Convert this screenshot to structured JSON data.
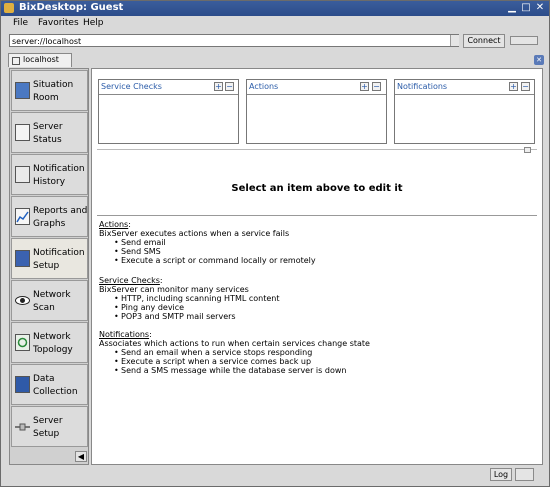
{
  "window": {
    "title": "BixDesktop: Guest"
  },
  "menu": [
    "File",
    "Favorites",
    "Help"
  ],
  "address": {
    "value": "server://localhost",
    "connect_label": "Connect"
  },
  "tab": {
    "label": "localhost"
  },
  "sidebar": {
    "items": [
      {
        "label": "Situation Room",
        "icon": "monitor-icon"
      },
      {
        "label": "Server Status",
        "icon": "checklist-icon"
      },
      {
        "label": "Notification History",
        "icon": "documents-icon"
      },
      {
        "label": "Reports and Graphs",
        "icon": "graph-icon"
      },
      {
        "label": "Notification Setup",
        "icon": "notification-setup-icon"
      },
      {
        "label": "Network Scan",
        "icon": "eye-icon"
      },
      {
        "label": "Network Topology",
        "icon": "topology-icon"
      },
      {
        "label": "Data Collection",
        "icon": "book-icon"
      },
      {
        "label": "Server Setup",
        "icon": "network-plug-icon"
      }
    ],
    "active_index": 4
  },
  "panels": [
    {
      "title": "Service Checks",
      "add": "+",
      "remove": "−"
    },
    {
      "title": "Actions",
      "add": "+",
      "remove": "−"
    },
    {
      "title": "Notifications",
      "add": "+",
      "remove": "−"
    }
  ],
  "main": {
    "prompt": "Select an item above to edit it"
  },
  "help": {
    "actions": {
      "heading": "Actions",
      "desc": "BixServer executes actions when a service fails",
      "bullets": [
        "Send email",
        "Send SMS",
        "Execute a script or command locally or remotely"
      ]
    },
    "service_checks": {
      "heading": "Service Checks",
      "desc": "BixServer can monitor many services",
      "bullets": [
        "HTTP, including scanning HTML content",
        "Ping any device",
        "POP3 and SMTP mail servers"
      ]
    },
    "notifications": {
      "heading": "Notifications",
      "desc": "Associates which actions to run when certain services change state",
      "bullets": [
        "Send an email when a service stops responding",
        "Execute a script when a service comes back up",
        "Send a SMS message while the database server is down"
      ]
    }
  },
  "status": {
    "log_label": "Log"
  },
  "colors": {
    "title_bar": "#2c4c8a",
    "panel_title": "#2a5ba8"
  }
}
